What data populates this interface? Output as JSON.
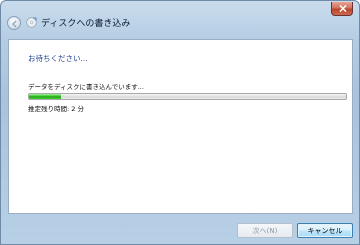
{
  "window": {
    "title": "ディスクへの書き込み",
    "close_icon": "close-icon",
    "back_icon": "back-arrow-icon",
    "app_icon": "disc-burn-icon"
  },
  "main": {
    "heading": "お待ちください...",
    "status": "データをディスクに書き込んでいます...",
    "progress": {
      "value": 0.1
    },
    "time_remaining": "推定残り時間: 2 分"
  },
  "footer": {
    "next_label": "次へ(N)",
    "cancel_label": "キャンセル"
  },
  "colors": {
    "heading": "#1f3f8f",
    "progress_fill": "#37c72c"
  }
}
